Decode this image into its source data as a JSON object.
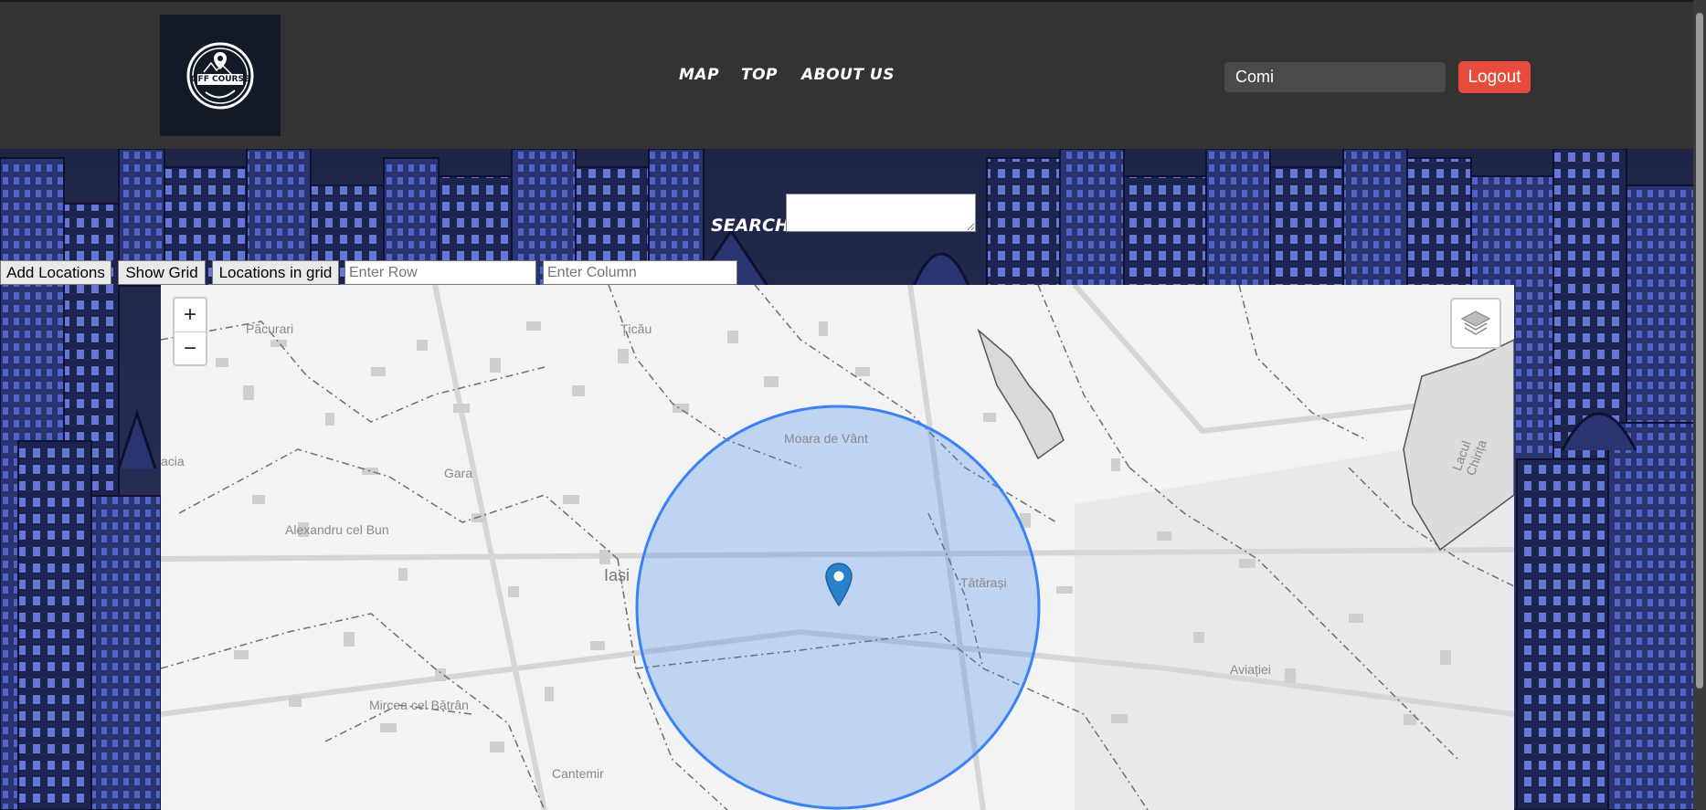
{
  "header": {
    "logo_text": "OFF COURSE",
    "nav": [
      "MAP",
      "TOP",
      "ABOUT US"
    ],
    "username": "Comi",
    "logout_label": "Logout"
  },
  "search": {
    "label": "SEARCH:"
  },
  "toolbar": {
    "add_locations": "Add Locations",
    "show_grid": "Show Grid",
    "locations_in_grid": "Locations in grid",
    "row_placeholder": "Enter Row",
    "column_placeholder": "Enter Column"
  },
  "map": {
    "zoom_in": "+",
    "zoom_out": "−",
    "labels": {
      "bacarari": "Păcurari",
      "ticau": "Țicău",
      "moara": "Moara de Vânt",
      "gara": "Gara",
      "alexandru": "Alexandru cel Bun",
      "iasi": "Iași",
      "tatarasi": "Tătărași",
      "aviatiei": "Aviației",
      "mircea": "Mircea cel Bătrân",
      "cantemir": "Cantemir",
      "lacul": "Lacul Chirița",
      "acia": "acia"
    },
    "circle_color": "#3b82f6",
    "marker_color": "#2a81cb"
  }
}
